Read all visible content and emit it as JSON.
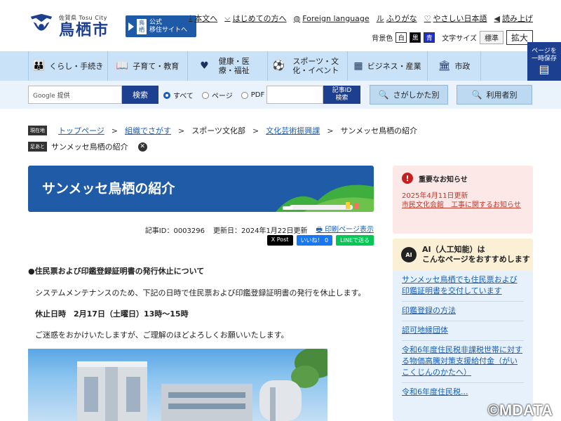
{
  "header": {
    "logo_small": "佐賀県 Tosu City",
    "logo_big": "鳥栖市",
    "banner_tag": "鳥栖",
    "banner_line1": "公式",
    "banner_line2": "移住サイトへ",
    "util": [
      {
        "icon": "download-icon",
        "label": "本文へ"
      },
      {
        "icon": "beginner-icon",
        "label": "はじめての方へ"
      },
      {
        "icon": "globe-icon",
        "label": "Foreign language"
      },
      {
        "icon": "ruby-icon",
        "label": "ふりがな"
      },
      {
        "icon": "heart-icon",
        "label": "やさしい日本語"
      },
      {
        "icon": "speaker-icon",
        "label": "読み上げ"
      }
    ],
    "bg_label": "背景色",
    "bg_white": "白",
    "bg_black": "黒",
    "bg_blue": "青",
    "fontsize_label": "文字サイズ",
    "fontsize_standard": "標準",
    "fontsize_large": "拡大"
  },
  "nav": {
    "items": [
      {
        "icon": "family-icon",
        "label": "くらし・手続き"
      },
      {
        "icon": "book-icon",
        "label": "子育て・教育"
      },
      {
        "icon": "heart-icon",
        "label": "健康・医療・福祉"
      },
      {
        "icon": "ball-icon",
        "label": "スポーツ・文化・イベント"
      },
      {
        "icon": "building-icon",
        "label": "ビジネス・産業"
      },
      {
        "icon": "cityhall-icon",
        "label": "市政"
      }
    ],
    "keep_line1": "ページを",
    "keep_line2": "一時保存"
  },
  "search": {
    "google_label": "Google",
    "google_sub": "提供",
    "button": "検索",
    "radio_all": "すべて",
    "radio_page": "ページ",
    "radio_pdf": "PDF",
    "id_line1": "記事ID",
    "id_line2": "検索",
    "find_by_search": "さがしかた別",
    "find_by_user": "利用者別"
  },
  "breadcrumb": {
    "current_tag": "現在地",
    "trail_tag": "足あと",
    "items": [
      "トップページ",
      "組織でさがす",
      "スポーツ文化部",
      "文化芸術振興課",
      "サンメッセ鳥栖の紹介"
    ],
    "trail_item": "サンメッセ鳥栖の紹介"
  },
  "main": {
    "title": "サンメッセ鳥栖の紹介",
    "article_id": "記事ID：0003296",
    "updated": "更新日：2024年1月22日更新",
    "print": "印刷ページ表示",
    "share_x": "X Post",
    "share_fb": "いいね！ 0",
    "share_line": "LINEで送る",
    "heading": "●住民票および印鑑登録証明書の発行休止について",
    "para1": "システムメンテナンスのため、下記の日時で住民票および印鑑登録証明書の発行を休止します。",
    "para2": "休止日時　2月17日（土曜日）13時～15時",
    "para3": "ご迷惑をおかけいたしますが、ご理解のほどよろしくお願いいたします。"
  },
  "sidebar": {
    "alert_title": "重要なお知らせ",
    "alert_date": "2025年4月11日更新",
    "alert_link": "市民文化会館　工事に関するお知らせ",
    "ai_badge": "AI",
    "ai_title1": "AI（人工知能）は",
    "ai_title2": "こんなページをおすすめします",
    "ai_links": [
      "サンメッセ鳥栖でも住民票および印鑑証明書を交付しています",
      "印鑑登録の方法",
      "認可地縁団体",
      "令和6年度住民税非課税世帯に対する物価高騰対策支援給付金（がいこくじんのかたへ）",
      "令和6年度住民税..."
    ]
  },
  "watermark": "©MDATA",
  "colors": {
    "brand": "#1c3f8f",
    "nav_bg": "#c9e2f7",
    "title_bg": "#1f5ba6",
    "alert_bg": "#fde8e8",
    "link": "#1a5fb4"
  }
}
